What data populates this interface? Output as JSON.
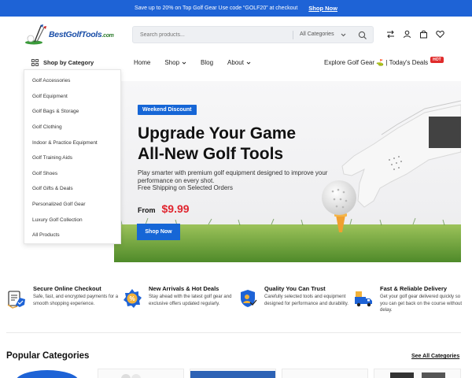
{
  "promo": {
    "text": "Save up to 20% on Top Golf Gear Use code “GOLF20” at checkout",
    "cta": "Shop Now"
  },
  "header": {
    "logo_text": "BestGolfTools",
    "logo_suffix": ".com",
    "search_placeholder": "Search products...",
    "search_category": "All Categories",
    "icons": [
      "compare-icon",
      "user-icon",
      "cart-icon",
      "heart-icon"
    ]
  },
  "nav": {
    "category_label": "Shop by Category",
    "links": [
      {
        "label": "Home",
        "has_dropdown": false
      },
      {
        "label": "Shop",
        "has_dropdown": true
      },
      {
        "label": "Blog",
        "has_dropdown": false
      },
      {
        "label": "About",
        "has_dropdown": true
      }
    ],
    "right_text": "Explore Golf Gear ⛳️ | Today's Deals",
    "hot_badge": "HOT"
  },
  "categories": [
    "Golf Accessories",
    "Golf Equipment",
    "Golf Bags & Storage",
    "Golf Clothing",
    "Indoor & Practice Equipment",
    "Golf Training Aids",
    "Golf Shoes",
    "Golf Gifts & Deals",
    "Personalized Golf Gear",
    "Luxury Golf Collection",
    "All Products"
  ],
  "hero": {
    "badge": "Weekend Discount",
    "title_line1": "Upgrade Your Game",
    "title_line2": "All-New Golf Tools",
    "description": "Play smarter with premium golf equipment designed to improve your performance on every shot.",
    "shipping": "Free Shipping on Selected Orders",
    "from_label": "From",
    "price": "$9.99",
    "button": "Shop Now"
  },
  "features": [
    {
      "title": "Secure Online Checkout",
      "text": "Safe, fast, and encrypted payments for a smooth shopping experience.",
      "icon": "secure-checkout-icon"
    },
    {
      "title": "New Arrivals & Hot Deals",
      "text": "Stay ahead with the latest golf gear and exclusive offers updated regularly.",
      "icon": "deals-badge-icon"
    },
    {
      "title": "Quality You Can Trust",
      "text": "Carefully selected tools and equipment designed for performance and durability.",
      "icon": "quality-trust-icon"
    },
    {
      "title": "Fast & Reliable Delivery",
      "text": "Get your golf gear delivered quickly so you can get back on the course without delay.",
      "icon": "delivery-truck-icon"
    }
  ],
  "popular": {
    "title": "Popular Categories",
    "see_all": "See All Categories"
  },
  "colors": {
    "brand_blue": "#1e63d6",
    "price_red": "#e0242e",
    "hot_red": "#e02b2b",
    "logo_blue": "#1b4fa8"
  }
}
